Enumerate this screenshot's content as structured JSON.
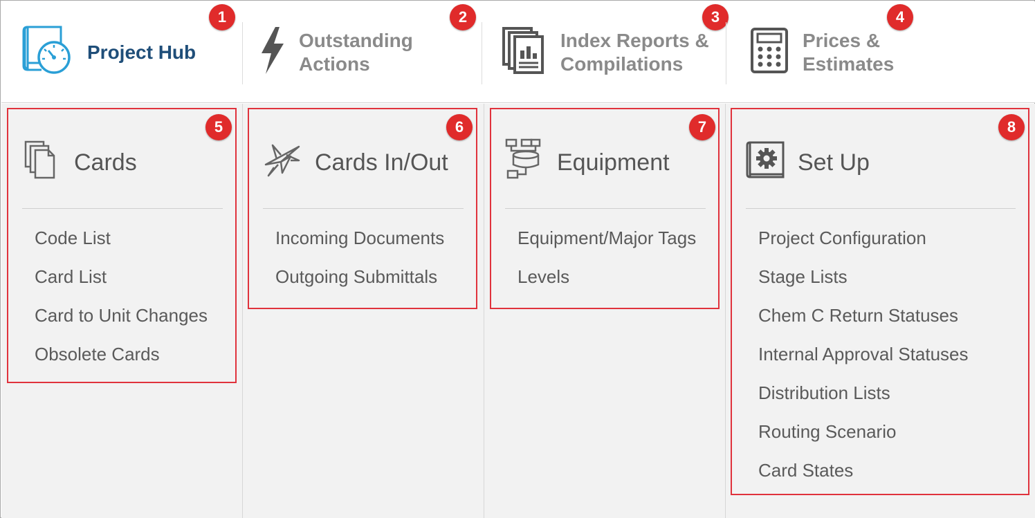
{
  "colors": {
    "accent": "#1f4e79",
    "icon_blue": "#2a9fd6",
    "badge": "#e02b2b",
    "panel_border": "#e0323c"
  },
  "nav": {
    "items": [
      {
        "id": 1,
        "label_line1": "Project Hub",
        "label_line2": "",
        "icon": "project-hub-gauge-icon",
        "active": true,
        "badge": "1"
      },
      {
        "id": 2,
        "label_line1": "Outstanding",
        "label_line2": "Actions",
        "icon": "lightning-bolt-icon",
        "active": false,
        "badge": "2"
      },
      {
        "id": 3,
        "label_line1": "Index Reports &",
        "label_line2": "Compilations",
        "icon": "reports-stack-icon",
        "active": false,
        "badge": "3"
      },
      {
        "id": 4,
        "label_line1": "Prices &",
        "label_line2": "Estimates",
        "icon": "calculator-icon",
        "active": false,
        "badge": "4"
      }
    ]
  },
  "panels": [
    {
      "title": "Cards",
      "icon": "cards-stack-icon",
      "badge": "5",
      "links": [
        "Code List",
        "Card List",
        "Card to Unit Changes",
        "Obsolete Cards"
      ]
    },
    {
      "title": "Cards In/Out",
      "icon": "paper-planes-icon",
      "badge": "6",
      "links": [
        "Incoming Documents",
        "Outgoing Submittals"
      ]
    },
    {
      "title": "Equipment",
      "icon": "equipment-diagram-icon",
      "badge": "7",
      "links": [
        "Equipment/Major Tags",
        "Levels"
      ]
    },
    {
      "title": "Set Up",
      "icon": "settings-gear-icon",
      "badge": "8",
      "links": [
        "Project Configuration",
        "Stage Lists",
        "Chem C Return Statuses",
        "Internal Approval Statuses",
        "Distribution Lists",
        "Routing Scenario",
        "Card States"
      ]
    }
  ]
}
